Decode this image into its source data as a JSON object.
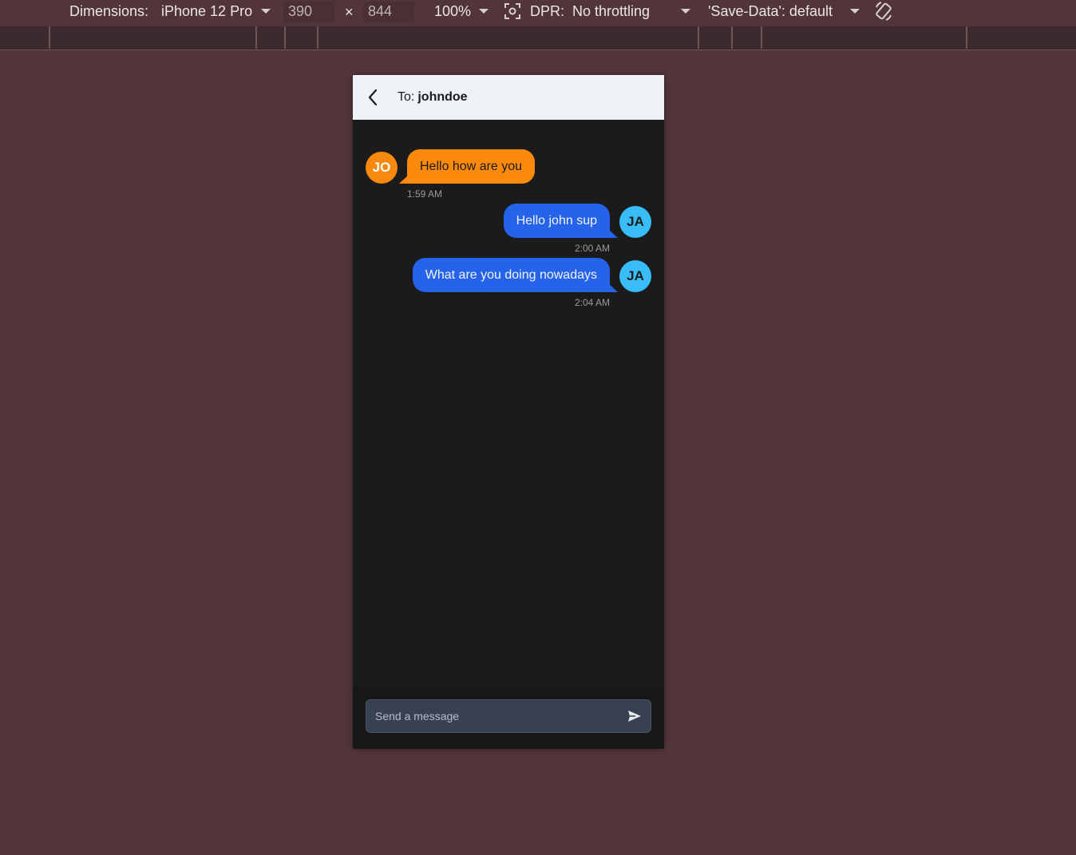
{
  "devtools": {
    "dimensions_label": "Dimensions:",
    "device": "iPhone 12 Pro",
    "width": "390",
    "times": "×",
    "height": "844",
    "zoom": "100%",
    "dpr_label": "DPR:",
    "throttling": "No throttling",
    "save_data": "'Save-Data': default"
  },
  "chat": {
    "to_label": "To:",
    "recipient": "johndoe",
    "messages": [
      {
        "direction": "in",
        "avatar": "JO",
        "text": "Hello how are you",
        "time": "1:59 AM"
      },
      {
        "direction": "out",
        "avatar": "JA",
        "text": "Hello john sup",
        "time": "2:00 AM"
      },
      {
        "direction": "out",
        "avatar": "JA",
        "text": "What are you doing nowadays",
        "time": "2:04 AM"
      }
    ],
    "composer": {
      "placeholder": "Send a message",
      "value": ""
    }
  },
  "icons": {
    "back": "chevron-left-icon",
    "send": "send-icon",
    "screenshot": "capture-icon",
    "rotate": "rotate-icon"
  },
  "colors": {
    "page_bg": "#51353a",
    "incoming_bubble": "#fb8a0c",
    "outgoing_bubble": "#2563eb",
    "outgoing_avatar": "#38bdf8",
    "chat_bg": "#1b1b1b"
  }
}
